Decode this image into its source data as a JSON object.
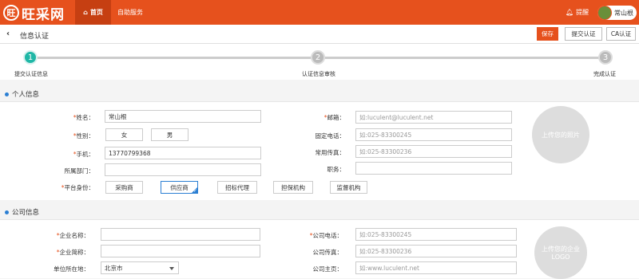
{
  "topbar": {
    "logo_mark": "旺",
    "logo_text": "旺采网",
    "nav_home": "首页",
    "nav_self_service": "自助服务",
    "remind_label": "提醒",
    "username": "常山根"
  },
  "subbar": {
    "title": "信息认证",
    "save_label": "保存",
    "submit_label": "提交认证",
    "ca_label": "CA认证"
  },
  "steps": [
    {
      "num": "1",
      "label": "提交认证信息",
      "active": true
    },
    {
      "num": "2",
      "label": "认证信息审核",
      "active": false
    },
    {
      "num": "3",
      "label": "完成认证",
      "active": false
    }
  ],
  "personal": {
    "section_title": "个人信息",
    "name_label": "姓名：",
    "name_value": "常山根",
    "gender_label": "性别：",
    "gender_options": [
      "女",
      "男"
    ],
    "phone_label": "手机：",
    "phone_value": "13770799368",
    "dept_label": "所属部门：",
    "identity_label": "平台身份：",
    "identity_options": [
      "采购商",
      "供应商",
      "招标代理",
      "担保机构",
      "监督机构"
    ],
    "identity_selected": "供应商",
    "email_label": "邮箱：",
    "email_placeholder": "如:luculent@luculent.net",
    "tel_label": "固定电话：",
    "tel_placeholder": "如:025-83300245",
    "fax_label": "常用传真：",
    "fax_placeholder": "如:025-83300236",
    "job_label": "职务：",
    "photo_text": "上传您的照片"
  },
  "company": {
    "section_title": "公司信息",
    "name_label": "企业名称：",
    "short_label": "企业简称：",
    "location_label": "单位所在地：",
    "location_value": "北京市",
    "phone_label": "公司电话：",
    "phone_placeholder": "如:025-83300245",
    "fax_label": "公司传真：",
    "fax_placeholder": "如:025-83300236",
    "homepage_label": "公司主页：",
    "homepage_placeholder": "如:www.luculent.net",
    "logo_text": "上传您的企业LOGO"
  },
  "colors": {
    "brand": "#e6511d",
    "step_active": "#1fb7a6",
    "select_blue": "#2b7fd3"
  }
}
